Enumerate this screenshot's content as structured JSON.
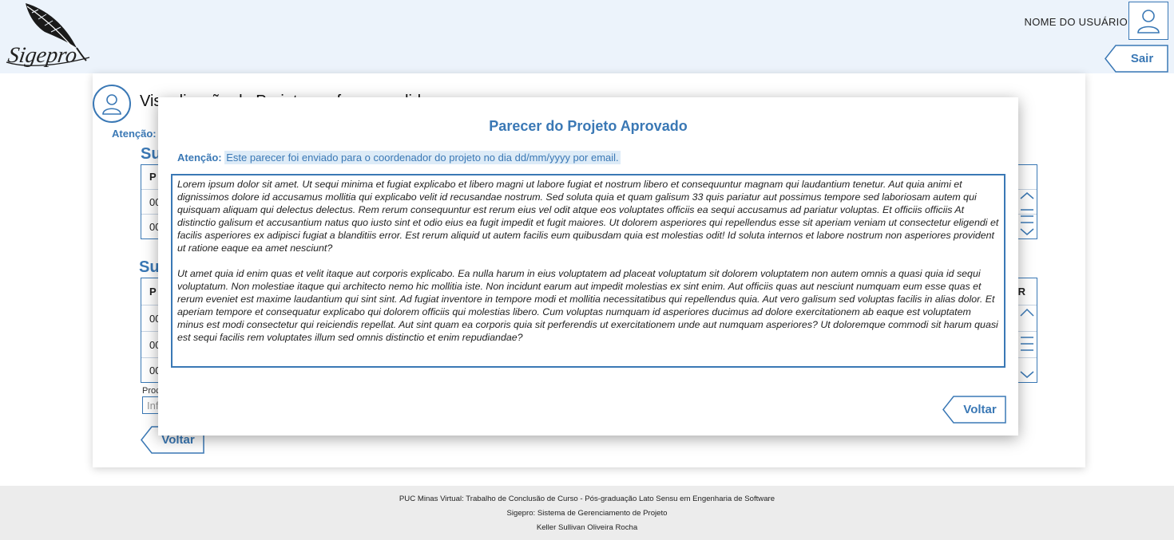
{
  "app": {
    "logo_text": "Sigepro",
    "username": "NOME DO USUÁRIO",
    "logout_label": "Sair"
  },
  "page": {
    "title": "Visualização do Projeto conforme pedido",
    "attention_label": "Atenção:",
    "section1_title": "Su",
    "section1_header_cell": "P",
    "section1_rows": [
      "00",
      "00"
    ],
    "section2_title": "Su",
    "section2_header_cell": "P",
    "section2_header_right": "R",
    "section2_rows": [
      "00",
      "00",
      "00"
    ],
    "field_label": "Proc",
    "field_placeholder": "Inf",
    "back_label": "Voltar"
  },
  "modal": {
    "title": "Parecer do Projeto Aprovado",
    "attention_label": "Atenção:",
    "attention_text": "Este parecer foi enviado para o coordenador do projeto no dia dd/mm/yyyy por email.",
    "paragraph1": "Lorem ipsum dolor sit amet. Ut sequi minima et fugiat explicabo et libero magni ut labore fugiat et nostrum libero et consequuntur magnam qui laudantium tenetur. Aut quia animi et dignissimos dolore id accusamus mollitia qui explicabo velit id recusandae nostrum. Sed soluta quia et quam galisum 33 quis pariatur aut possimus tempore sed laboriosam autem qui quisquam aliquam qui delectus delectus. Rem rerum consequuntur est rerum eius vel odit atque eos voluptates officiis ea sequi accusamus ad pariatur voluptas. Et officiis officiis At distinctio galisum et accusantium natus quo iusto sint et odio eius ea fugit impedit et fugit maiores. Ut dolorem asperiores qui repellendus esse sit aperiam veniam ut consectetur eligendi et facilis asperiores ex adipisci fugiat a blanditiis error. Est rerum aliquid ut autem facilis eum quibusdam quia est molestias odit! Id soluta internos et labore nostrum non asperiores provident ut ratione eaque ea amet nesciunt?",
    "paragraph2": "Ut amet quia id enim quas et velit itaque aut corporis explicabo. Ea nulla harum in eius voluptatem ad placeat voluptatum sit dolorem voluptatem non autem omnis a quasi quia id sequi voluptatum. Non molestiae itaque qui architecto nemo hic mollitia iste. Non incidunt earum aut impedit molestias ex sint enim. Aut officiis quas aut nesciunt numquam eum esse quas et rerum eveniet est maxime laudantium qui sint sint. Ad fugiat inventore in tempore modi et mollitia necessitatibus qui repellendus quia. Aut vero galisum sed voluptas facilis in alias dolor. Et aperiam tempore et consequatur explicabo qui dolorem officiis qui molestias libero. Cum voluptas numquam id asperiores ducimus ad dolore exercitationem ab eaque est voluptatem minus est modi consectetur qui reiciendis repellat. Aut sint quam ea corporis quia sit perferendis ut exercitationem unde aut numquam asperiores? Ut doloremque commodi sit harum quasi est sequi facilis rem voluptates illum sed omnis distinctio et enim repudiandae?",
    "back_label": "Voltar"
  },
  "footer": {
    "line1": "PUC Minas Virtual: Trabalho de Conclusão de Curso - Pós-graduação Lato Sensu em Engenharia de Software",
    "line2": "Sigepro: Sistema de Gerenciamento de Projeto",
    "line3": "Keller Sullivan Oliveira Rocha"
  },
  "colors": {
    "accent": "#3a78b5",
    "header_bg": "#ecf3fb",
    "footer_bg": "#ececec"
  }
}
